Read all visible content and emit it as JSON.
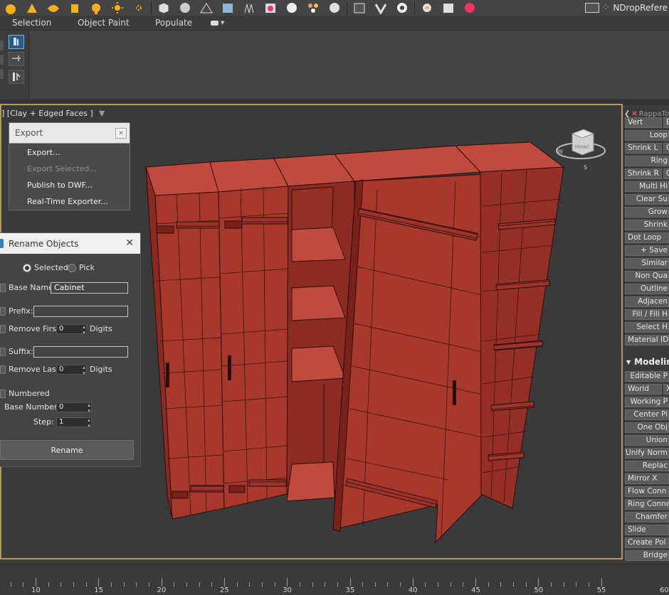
{
  "toolbar": {
    "icons": [
      "sphere-icon",
      "light-icon",
      "sun-icon",
      "geometry-icon",
      "flower-icon",
      "sun-light-icon",
      "sun-burst-icon",
      "cube-icon",
      "smoothing-icon",
      "terrain-icon",
      "scatter-icon",
      "grass-icon",
      "fire-icon",
      "sphere-shade-icon",
      "particles-icon",
      "material-icon",
      "vray-icon",
      "vray-logo-icon",
      "settings-icon",
      "gear-icon",
      "render-icon",
      "vray-frame-icon"
    ],
    "ndrop_label": "NDropRefere"
  },
  "ribbon": {
    "tabs": [
      "Selection",
      "Object Paint",
      "Populate"
    ]
  },
  "viewport": {
    "label": "] [Clay + Edged Faces ]",
    "viewcube_label": "FRONT",
    "compass": {
      "w": "W",
      "s": "S"
    }
  },
  "export_menu": {
    "title": "Export",
    "items": [
      {
        "label": "Export...",
        "enabled": true
      },
      {
        "label": "Export Selected...",
        "enabled": false
      },
      {
        "label": "Publish to DWF...",
        "enabled": true
      },
      {
        "label": "Real-Time Exporter...",
        "enabled": true
      }
    ]
  },
  "rename_dialog": {
    "title": "Rename Objects",
    "radio_selected": "Selected",
    "radio_pick": "Pick",
    "base_name_label": "Base Name:",
    "base_name_value": "Cabinet",
    "prefix_label": "Prefix:",
    "prefix_value": "",
    "remove_first_label": "Remove First:",
    "remove_first_value": "0",
    "digits_label": "Digits",
    "suffix_label": "Suffix:",
    "suffix_value": "",
    "remove_last_label": "Remove Last:",
    "remove_last_value": "0",
    "numbered_label": "Numbered",
    "base_number_label": "Base Number:",
    "base_number_value": "0",
    "step_label": "Step:",
    "step_value": "1",
    "rename_button": "Rename"
  },
  "right_panel": {
    "header": "RappaTo",
    "buttons": [
      {
        "label": "Vert",
        "label2": "Edge"
      },
      {
        "label": "Loop"
      },
      {
        "label": "Shrink L",
        "label2": "G"
      },
      {
        "label": "Ring"
      },
      {
        "label": "Shrink R",
        "label2": "G"
      },
      {
        "label": "Multi Hi"
      },
      {
        "label": "Clear Su"
      },
      {
        "label": "Grow"
      },
      {
        "label": "Shrink"
      },
      {
        "label": "Dot Loop"
      },
      {
        "label": "+ Save"
      },
      {
        "label": "Similar"
      },
      {
        "label": "Non Qua"
      },
      {
        "label": "Outline"
      },
      {
        "label": "Adjacen"
      },
      {
        "label": "Fill / Fill H"
      },
      {
        "label": "Select H"
      },
      {
        "label": "Material ID"
      }
    ],
    "modeling_header": "Modeling",
    "modeling_buttons": [
      {
        "label": "Editable P"
      },
      {
        "label": "World",
        "label2": "X"
      },
      {
        "label": "Working P"
      },
      {
        "label": "Center Pi"
      },
      {
        "label": "One Obj"
      },
      {
        "label": "Union"
      },
      {
        "label": "Unify Norm"
      },
      {
        "label": "Replac"
      },
      {
        "label": "Mirror X"
      },
      {
        "label": "Flow Conn"
      },
      {
        "label": "Ring Connect"
      },
      {
        "label": "Chamfer"
      },
      {
        "label": "Slide"
      },
      {
        "label": "Create Pol"
      },
      {
        "label": "Bridge"
      }
    ]
  },
  "timeline": {
    "labels": [
      "10",
      "15",
      "20",
      "25",
      "30",
      "35",
      "40",
      "45",
      "50",
      "55",
      "60"
    ]
  },
  "colors": {
    "cabinet_fill": "#a8372c",
    "cabinet_shade": "#8c2b22",
    "cabinet_light": "#c0473a",
    "viewport_border": "#b39a5a",
    "active_blue": "#2d5b86"
  }
}
